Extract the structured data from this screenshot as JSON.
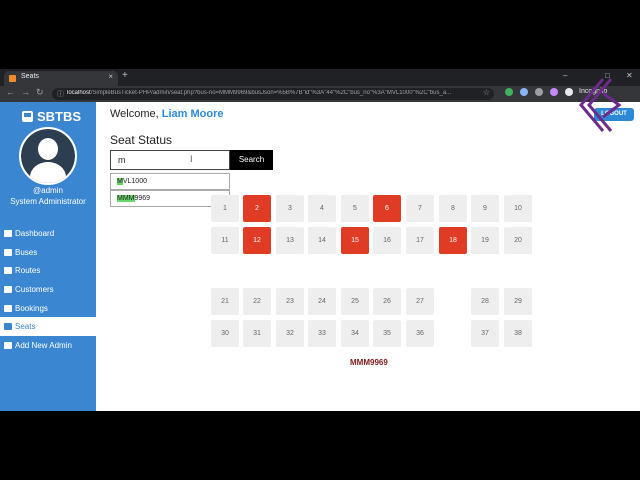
{
  "browser": {
    "tab_title": "Seats",
    "tab_close": "×",
    "new_tab": "+",
    "url_host": "localhost",
    "url_path": "/SimpleBusTicket-PHP/admin/seat.php?bus-no=MMM9969&busJson=%5B%7B\"id\"%3A\"44\"%2C\"bus_no\"%3A\"MVL1000\"%2C\"bus_a...",
    "profile_label": "Incognito",
    "nav_back": "←",
    "nav_forward": "→",
    "nav_reload": "↻",
    "info_icon": "ⓘ",
    "star_icon": "☆",
    "win_min": "–",
    "win_max": "□",
    "win_close": "✕"
  },
  "sidebar": {
    "brand": "SBTBS",
    "username": "@admin",
    "role": "System Administrator",
    "items": [
      {
        "label": "Dashboard",
        "icon": "tachometer-icon"
      },
      {
        "label": "Buses",
        "icon": "bus-icon"
      },
      {
        "label": "Routes",
        "icon": "road-icon"
      },
      {
        "label": "Customers",
        "icon": "users-icon"
      },
      {
        "label": "Bookings",
        "icon": "ticket-icon"
      },
      {
        "label": "Seats",
        "icon": "grid-icon",
        "active": true
      },
      {
        "label": "Add New Admin",
        "icon": "user-plus-icon"
      }
    ]
  },
  "header": {
    "welcome": "Welcome,",
    "user_name": "Liam Moore",
    "logout_label": "LOGOUT"
  },
  "main": {
    "title": "Seat Status",
    "search_value": "m",
    "search_button": "Search",
    "suggestions": [
      {
        "match": "M",
        "rest": "VL1000"
      },
      {
        "match": "MMM",
        "rest": "9969"
      }
    ],
    "seats_row1": [
      {
        "no": "1",
        "booked": false
      },
      {
        "no": "2",
        "booked": true
      },
      {
        "no": "3",
        "booked": false
      },
      {
        "no": "4",
        "booked": false
      },
      {
        "no": "5",
        "booked": false
      },
      {
        "no": "6",
        "booked": true
      },
      {
        "no": "7",
        "booked": false
      },
      {
        "no": "8",
        "booked": false
      },
      {
        "no": "9",
        "booked": false
      },
      {
        "no": "10",
        "booked": false
      }
    ],
    "seats_row2": [
      {
        "no": "11",
        "booked": false
      },
      {
        "no": "12",
        "booked": true
      },
      {
        "no": "13",
        "booked": false
      },
      {
        "no": "14",
        "booked": false
      },
      {
        "no": "15",
        "booked": true
      },
      {
        "no": "16",
        "booked": false
      },
      {
        "no": "17",
        "booked": false
      },
      {
        "no": "18",
        "booked": true
      },
      {
        "no": "19",
        "booked": false
      },
      {
        "no": "20",
        "booked": false
      }
    ],
    "seats_row3": [
      {
        "no": "21"
      },
      {
        "no": "22"
      },
      {
        "no": "23"
      },
      {
        "no": "24"
      },
      {
        "no": "25"
      },
      {
        "no": "26"
      },
      {
        "no": "27"
      },
      {
        "no": "28"
      },
      {
        "no": "29"
      }
    ],
    "seats_row4": [
      {
        "no": "30"
      },
      {
        "no": "31"
      },
      {
        "no": "32"
      },
      {
        "no": "33"
      },
      {
        "no": "34"
      },
      {
        "no": "35"
      },
      {
        "no": "36"
      },
      {
        "no": "37"
      },
      {
        "no": "38"
      }
    ],
    "bus_no": "MMM9969"
  },
  "colors": {
    "sidebar": "#3a86d1",
    "booked": "#e03b24",
    "available": "#eeeeee",
    "accent": "#2d89d6"
  }
}
